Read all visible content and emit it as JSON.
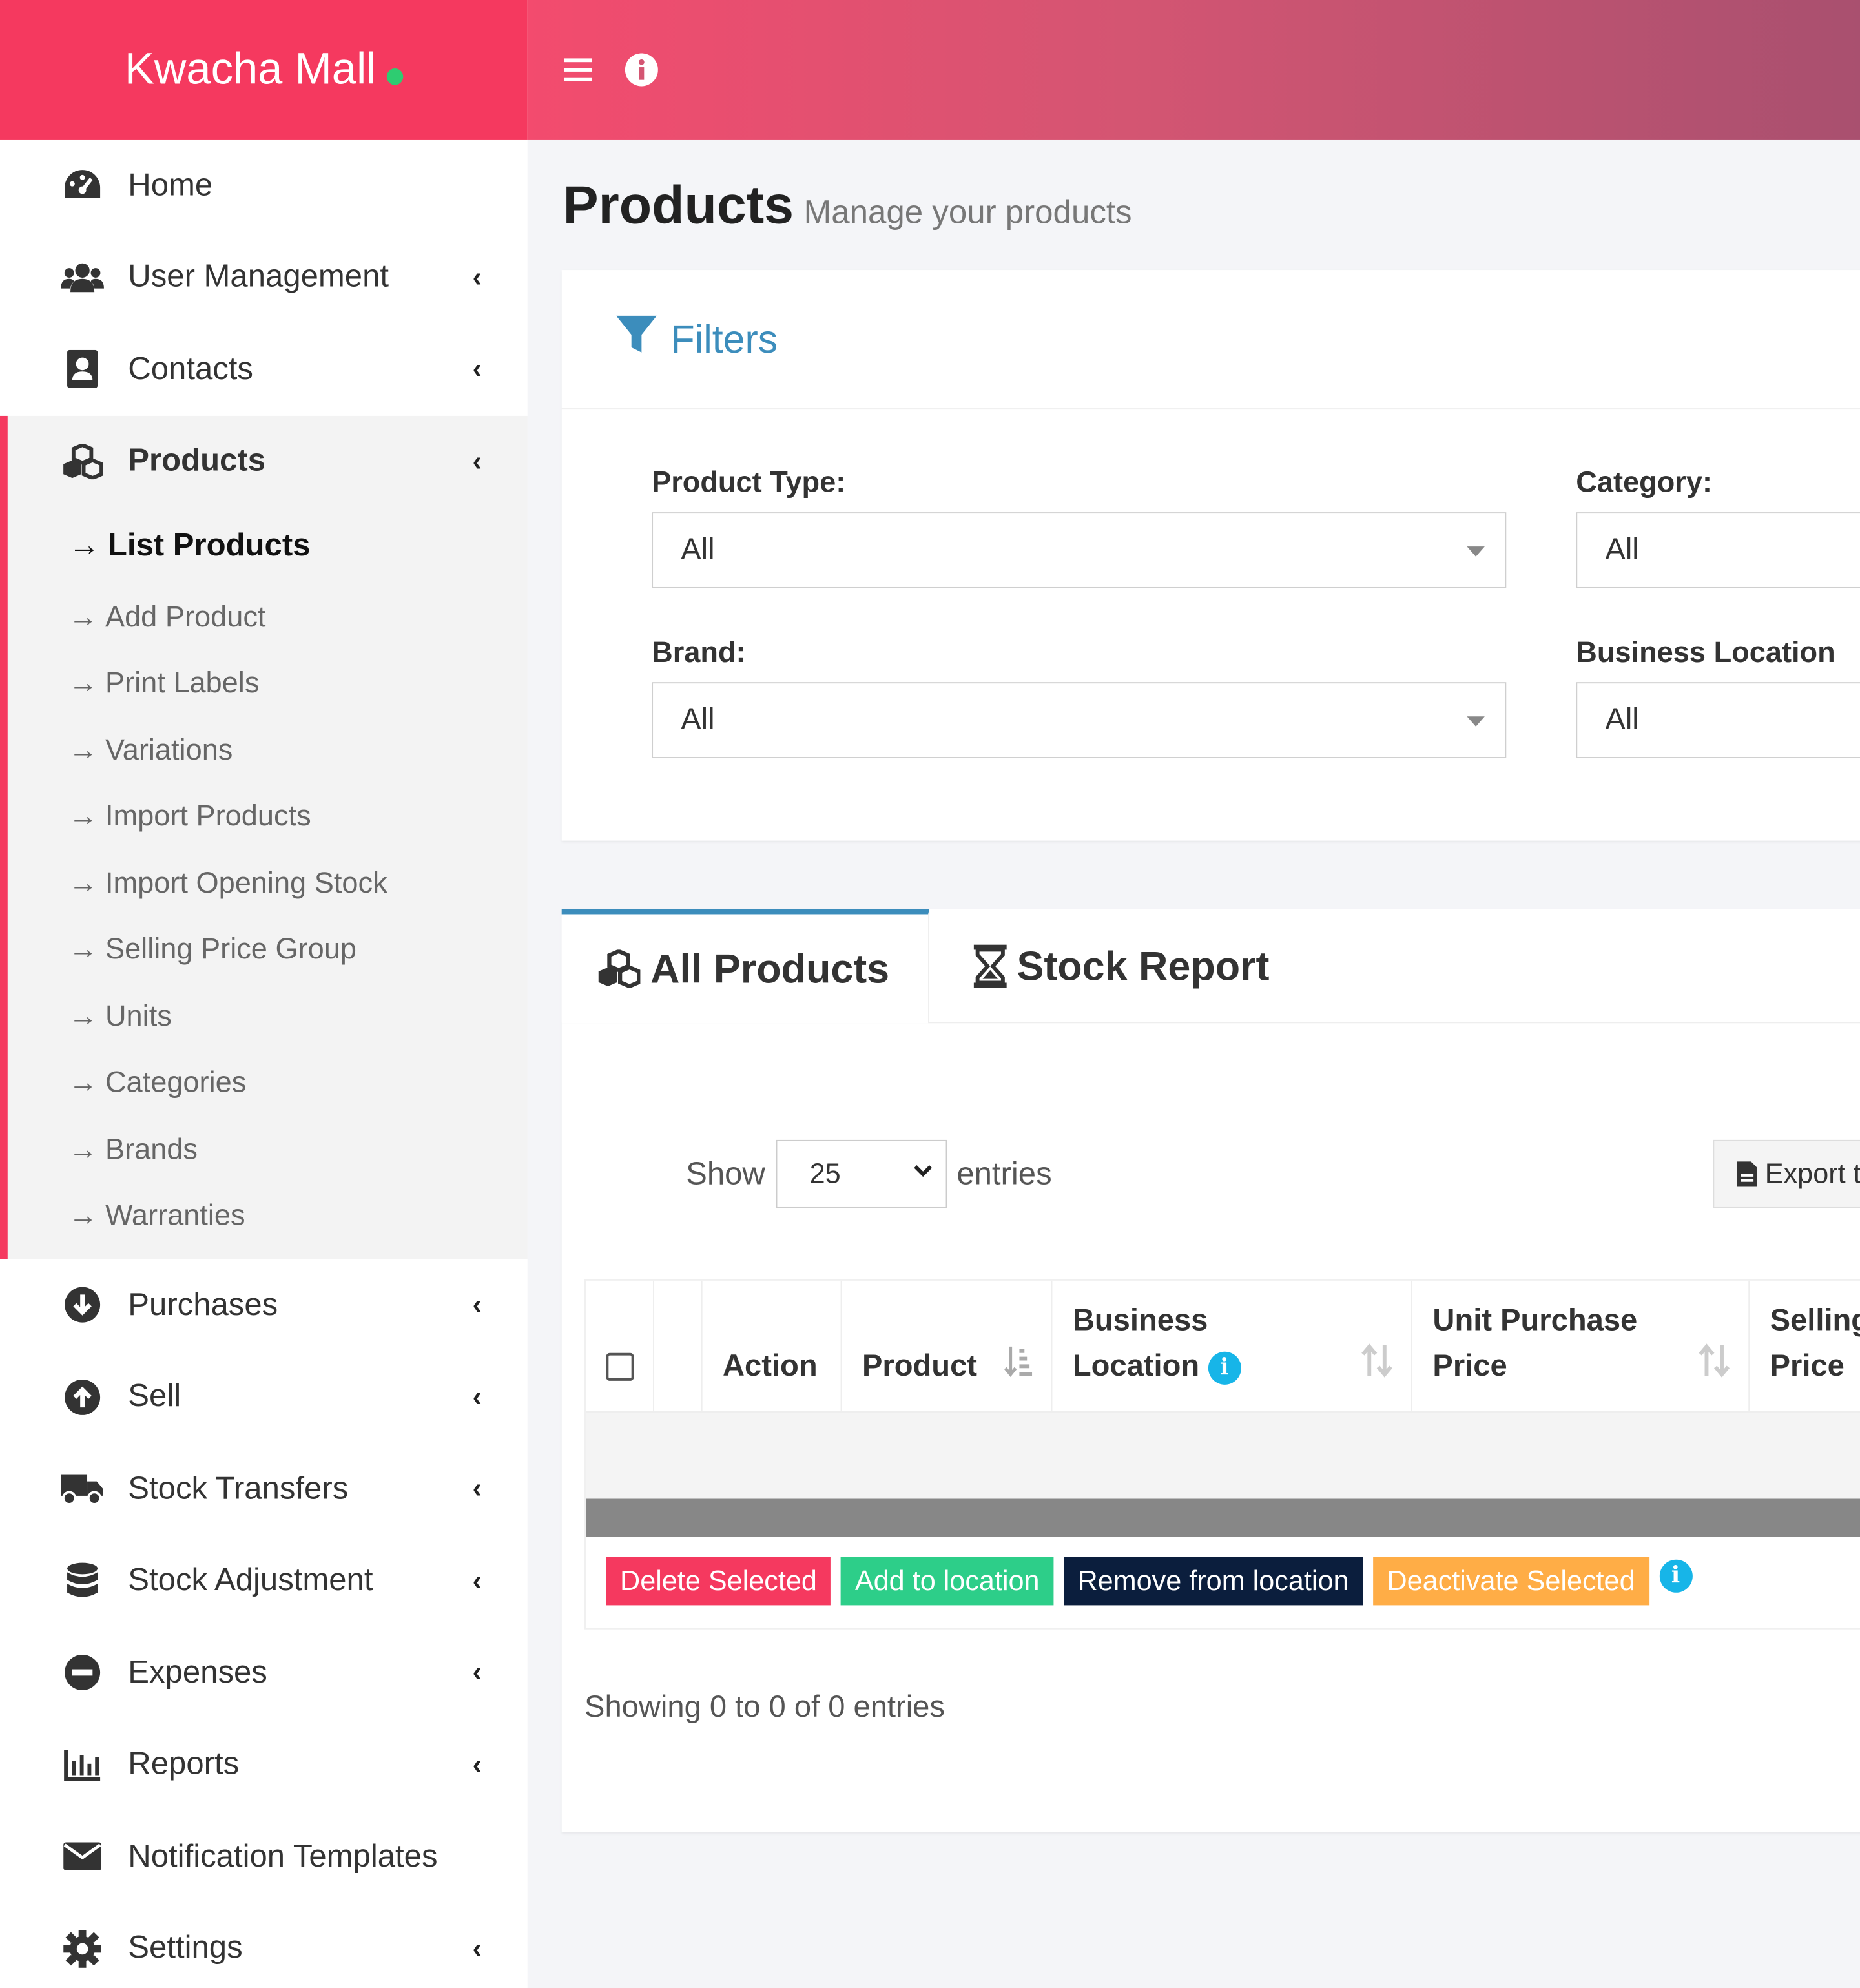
{
  "brand": {
    "name": "Kwacha Mall",
    "status_color": "#2ecc71",
    "color": "#f5395f"
  },
  "header": {
    "menu_icon": "hamburger-icon",
    "info_icon": "info-icon"
  },
  "sidebar": {
    "items_top": [
      {
        "label": "Home",
        "icon": "dashboard-icon",
        "has_children": false
      },
      {
        "label": "User Management",
        "icon": "users-icon",
        "has_children": true
      },
      {
        "label": "Contacts",
        "icon": "contact-book-icon",
        "has_children": true
      }
    ],
    "active": {
      "label": "Products",
      "icon": "cubes-icon",
      "children": [
        {
          "label": "List Products",
          "active": true
        },
        {
          "label": "Add Product"
        },
        {
          "label": "Print Labels"
        },
        {
          "label": "Variations"
        },
        {
          "label": "Import Products"
        },
        {
          "label": "Import Opening Stock"
        },
        {
          "label": "Selling Price Group"
        },
        {
          "label": "Units"
        },
        {
          "label": "Categories"
        },
        {
          "label": "Brands"
        },
        {
          "label": "Warranties"
        }
      ]
    },
    "items_bottom": [
      {
        "label": "Purchases",
        "icon": "arrow-circle-down-icon",
        "has_children": true
      },
      {
        "label": "Sell",
        "icon": "arrow-circle-up-icon",
        "has_children": true
      },
      {
        "label": "Stock Transfers",
        "icon": "truck-icon",
        "has_children": true
      },
      {
        "label": "Stock Adjustment",
        "icon": "database-icon",
        "has_children": true
      },
      {
        "label": "Expenses",
        "icon": "minus-circle-icon",
        "has_children": true
      },
      {
        "label": "Reports",
        "icon": "bar-chart-icon",
        "has_children": true
      },
      {
        "label": "Notification Templates",
        "icon": "envelope-icon",
        "has_children": false
      },
      {
        "label": "Settings",
        "icon": "cog-icon",
        "has_children": true
      }
    ],
    "arrow": "→",
    "chevron": "‹"
  },
  "page": {
    "title": "Products",
    "subtitle": "Manage your products"
  },
  "filters": {
    "title": "Filters",
    "product_type": {
      "label": "Product Type:",
      "value": "All"
    },
    "category": {
      "label": "Category:",
      "value": "All"
    },
    "brand": {
      "label": "Brand:",
      "value": "All"
    },
    "business_location": {
      "label": "Business Location",
      "value": "All"
    }
  },
  "tabs": [
    {
      "label": "All Products",
      "icon": "cubes-icon",
      "active": true
    },
    {
      "label": "Stock Report",
      "icon": "hourglass-icon",
      "active": false
    }
  ],
  "table": {
    "show_label": "Show",
    "entries_label": "entries",
    "page_length": "25",
    "export_label": "Export t",
    "columns": [
      "Action",
      "Product",
      "Business",
      "Location",
      "Unit Purchase",
      "Price",
      "Selling",
      "Price"
    ],
    "actions": [
      "Delete Selected",
      "Add to location",
      "Remove from location",
      "Deactivate Selected"
    ],
    "info": "Showing 0 to 0 of 0 entries"
  }
}
